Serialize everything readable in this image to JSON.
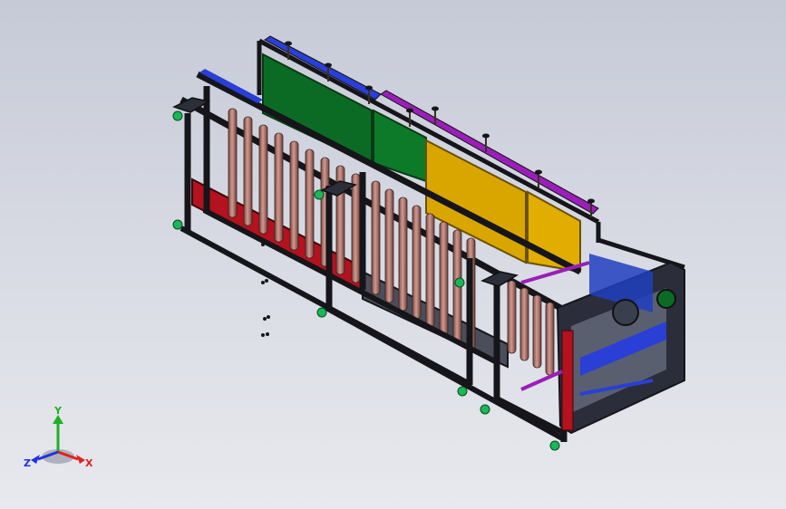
{
  "viewport": {
    "background_top": "#c6cad7",
    "background_bottom": "#e8e9ee"
  },
  "model": {
    "description_icon": "cad-assembly-frame-icon",
    "colors": {
      "frame": "#1c1c22",
      "green_panel": "#0b6b25",
      "yellow_panel": "#d9a600",
      "red_base": "#b3121e",
      "blue_rail": "#2a3fd6",
      "purple_rail": "#9a1fb8",
      "cylinder": "#b07a72",
      "green_foot": "#19b75a"
    }
  },
  "triad": {
    "x_label": "X",
    "y_label": "Y",
    "z_label": "Z",
    "x_color": "#e02020",
    "y_color": "#20b020",
    "z_color": "#2030e0"
  }
}
